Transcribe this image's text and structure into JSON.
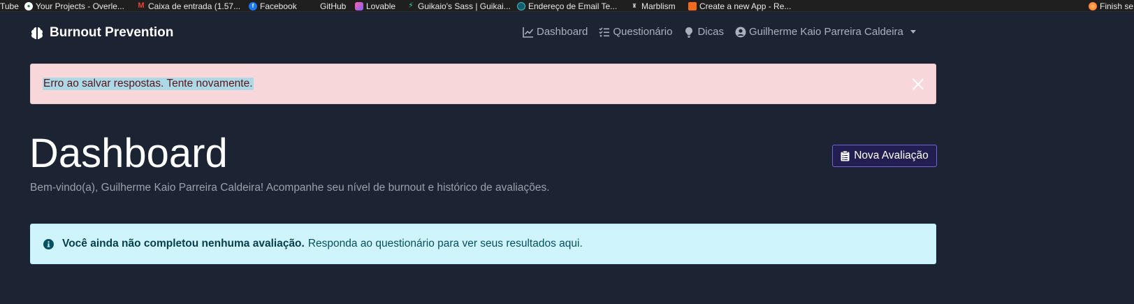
{
  "bookmarks": [
    {
      "label": "Tube",
      "icon": "youtube-icon"
    },
    {
      "label": "Your Projects - Overle...",
      "icon": "overleaf-icon"
    },
    {
      "label": "Caixa de entrada (1.57...",
      "icon": "gmail-icon"
    },
    {
      "label": "Facebook",
      "icon": "facebook-icon"
    },
    {
      "label": "GitHub",
      "icon": "github-icon"
    },
    {
      "label": "Lovable",
      "icon": "lovable-icon"
    },
    {
      "label": "Guikaio's Sass | Guikai...",
      "icon": "supabase-icon"
    },
    {
      "label": "Endereço de Email Te...",
      "icon": "tempmail-icon"
    },
    {
      "label": "Marblism",
      "icon": "marblism-icon"
    },
    {
      "label": "Create a new App - Re...",
      "icon": "app-icon"
    },
    {
      "label": "Finish se",
      "icon": "firefox-icon"
    }
  ],
  "navbar": {
    "brand": "Burnout Prevention",
    "links": {
      "dashboard": "Dashboard",
      "questionario": "Questionário",
      "dicas": "Dicas",
      "user": "Guilherme Kaio Parreira Caldeira"
    }
  },
  "alert_error": {
    "message": "Erro ao salvar respostas. Tente novamente."
  },
  "main": {
    "title": "Dashboard",
    "subtitle": "Bem-vindo(a), Guilherme Kaio Parreira Caldeira! Acompanhe seu nível de burnout e histórico de avaliações.",
    "new_button": "Nova Avaliação"
  },
  "alert_info": {
    "strong": "Você ainda não completou nenhuma avaliação.",
    "text": "Responda ao questionário para ver seus resultados aqui."
  },
  "colors": {
    "background": "#1c2333",
    "danger_bg": "#f8d7da",
    "info_bg": "#cff4fc",
    "accent_button_border": "#6f63d8"
  }
}
